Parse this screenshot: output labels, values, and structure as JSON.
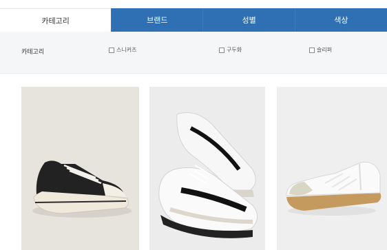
{
  "tabs": [
    {
      "label": "카테고리",
      "active": true
    },
    {
      "label": "브랜드",
      "active": false
    },
    {
      "label": "성별",
      "active": false
    },
    {
      "label": "색상",
      "active": false
    }
  ],
  "filter": {
    "label": "카테고리",
    "options": [
      {
        "label": "스니커즈",
        "checked": false
      },
      {
        "label": "구두화",
        "checked": false
      },
      {
        "label": "슬리퍼",
        "checked": false
      }
    ]
  },
  "colors": {
    "tab_active_bg": "#ffffff",
    "tab_bg": "#2f6fb3",
    "filter_bg": "#f5f6f8"
  }
}
